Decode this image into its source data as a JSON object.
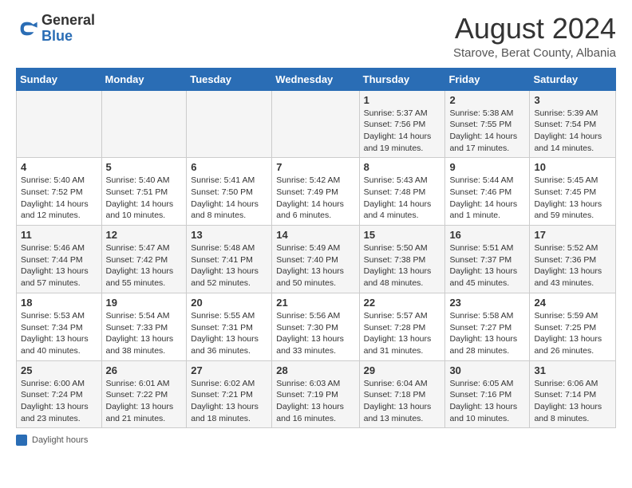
{
  "header": {
    "logo": {
      "general": "General",
      "blue": "Blue"
    },
    "title": "August 2024",
    "location": "Starove, Berat County, Albania"
  },
  "calendar": {
    "days_of_week": [
      "Sunday",
      "Monday",
      "Tuesday",
      "Wednesday",
      "Thursday",
      "Friday",
      "Saturday"
    ],
    "weeks": [
      [
        {
          "day": "",
          "info": ""
        },
        {
          "day": "",
          "info": ""
        },
        {
          "day": "",
          "info": ""
        },
        {
          "day": "",
          "info": ""
        },
        {
          "day": "1",
          "info": "Sunrise: 5:37 AM\nSunset: 7:56 PM\nDaylight: 14 hours and 19 minutes."
        },
        {
          "day": "2",
          "info": "Sunrise: 5:38 AM\nSunset: 7:55 PM\nDaylight: 14 hours and 17 minutes."
        },
        {
          "day": "3",
          "info": "Sunrise: 5:39 AM\nSunset: 7:54 PM\nDaylight: 14 hours and 14 minutes."
        }
      ],
      [
        {
          "day": "4",
          "info": "Sunrise: 5:40 AM\nSunset: 7:52 PM\nDaylight: 14 hours and 12 minutes."
        },
        {
          "day": "5",
          "info": "Sunrise: 5:40 AM\nSunset: 7:51 PM\nDaylight: 14 hours and 10 minutes."
        },
        {
          "day": "6",
          "info": "Sunrise: 5:41 AM\nSunset: 7:50 PM\nDaylight: 14 hours and 8 minutes."
        },
        {
          "day": "7",
          "info": "Sunrise: 5:42 AM\nSunset: 7:49 PM\nDaylight: 14 hours and 6 minutes."
        },
        {
          "day": "8",
          "info": "Sunrise: 5:43 AM\nSunset: 7:48 PM\nDaylight: 14 hours and 4 minutes."
        },
        {
          "day": "9",
          "info": "Sunrise: 5:44 AM\nSunset: 7:46 PM\nDaylight: 14 hours and 1 minute."
        },
        {
          "day": "10",
          "info": "Sunrise: 5:45 AM\nSunset: 7:45 PM\nDaylight: 13 hours and 59 minutes."
        }
      ],
      [
        {
          "day": "11",
          "info": "Sunrise: 5:46 AM\nSunset: 7:44 PM\nDaylight: 13 hours and 57 minutes."
        },
        {
          "day": "12",
          "info": "Sunrise: 5:47 AM\nSunset: 7:42 PM\nDaylight: 13 hours and 55 minutes."
        },
        {
          "day": "13",
          "info": "Sunrise: 5:48 AM\nSunset: 7:41 PM\nDaylight: 13 hours and 52 minutes."
        },
        {
          "day": "14",
          "info": "Sunrise: 5:49 AM\nSunset: 7:40 PM\nDaylight: 13 hours and 50 minutes."
        },
        {
          "day": "15",
          "info": "Sunrise: 5:50 AM\nSunset: 7:38 PM\nDaylight: 13 hours and 48 minutes."
        },
        {
          "day": "16",
          "info": "Sunrise: 5:51 AM\nSunset: 7:37 PM\nDaylight: 13 hours and 45 minutes."
        },
        {
          "day": "17",
          "info": "Sunrise: 5:52 AM\nSunset: 7:36 PM\nDaylight: 13 hours and 43 minutes."
        }
      ],
      [
        {
          "day": "18",
          "info": "Sunrise: 5:53 AM\nSunset: 7:34 PM\nDaylight: 13 hours and 40 minutes."
        },
        {
          "day": "19",
          "info": "Sunrise: 5:54 AM\nSunset: 7:33 PM\nDaylight: 13 hours and 38 minutes."
        },
        {
          "day": "20",
          "info": "Sunrise: 5:55 AM\nSunset: 7:31 PM\nDaylight: 13 hours and 36 minutes."
        },
        {
          "day": "21",
          "info": "Sunrise: 5:56 AM\nSunset: 7:30 PM\nDaylight: 13 hours and 33 minutes."
        },
        {
          "day": "22",
          "info": "Sunrise: 5:57 AM\nSunset: 7:28 PM\nDaylight: 13 hours and 31 minutes."
        },
        {
          "day": "23",
          "info": "Sunrise: 5:58 AM\nSunset: 7:27 PM\nDaylight: 13 hours and 28 minutes."
        },
        {
          "day": "24",
          "info": "Sunrise: 5:59 AM\nSunset: 7:25 PM\nDaylight: 13 hours and 26 minutes."
        }
      ],
      [
        {
          "day": "25",
          "info": "Sunrise: 6:00 AM\nSunset: 7:24 PM\nDaylight: 13 hours and 23 minutes."
        },
        {
          "day": "26",
          "info": "Sunrise: 6:01 AM\nSunset: 7:22 PM\nDaylight: 13 hours and 21 minutes."
        },
        {
          "day": "27",
          "info": "Sunrise: 6:02 AM\nSunset: 7:21 PM\nDaylight: 13 hours and 18 minutes."
        },
        {
          "day": "28",
          "info": "Sunrise: 6:03 AM\nSunset: 7:19 PM\nDaylight: 13 hours and 16 minutes."
        },
        {
          "day": "29",
          "info": "Sunrise: 6:04 AM\nSunset: 7:18 PM\nDaylight: 13 hours and 13 minutes."
        },
        {
          "day": "30",
          "info": "Sunrise: 6:05 AM\nSunset: 7:16 PM\nDaylight: 13 hours and 10 minutes."
        },
        {
          "day": "31",
          "info": "Sunrise: 6:06 AM\nSunset: 7:14 PM\nDaylight: 13 hours and 8 minutes."
        }
      ]
    ]
  },
  "footer": {
    "daylight_label": "Daylight hours"
  }
}
